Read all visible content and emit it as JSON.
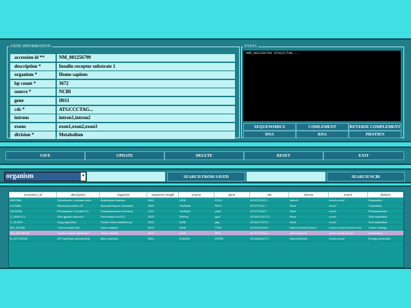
{
  "gene_info": {
    "legend": "GENE INFORMATION",
    "fields": [
      {
        "label": "accession id **",
        "value": "NM_001256799"
      },
      {
        "label": "description *",
        "value": "Insulin receptor substrate 1"
      },
      {
        "label": "organism *",
        "value": "Homo sapiens"
      },
      {
        "label": "bp count *",
        "value": "3672"
      },
      {
        "label": "source *",
        "value": "NCBI"
      },
      {
        "label": "gene",
        "value": "IRS1"
      },
      {
        "label": "cds *",
        "value": "ATGCCCTAG..."
      },
      {
        "label": "introns",
        "value": "intron1,intron2"
      },
      {
        "label": "exons",
        "value": "exon1,exon2,exon3"
      },
      {
        "label": "division *",
        "value": "Metabolism"
      }
    ]
  },
  "fasta": {
    "legend": "FASTA",
    "content": ">NM_001256799 ATGCCCTAG...",
    "buttons": {
      "sequenomics": "SEQUENOMICS",
      "complement": "COMLEMENT",
      "reverse_complement": "REVERSE COMPLEMENT",
      "dna": "DNA",
      "rna": "RNA",
      "protein": "PROTIEN"
    }
  },
  "actions": {
    "save": "SAVE",
    "update": "UPDATE",
    "delete": "DELETE",
    "reset": "RESET",
    "exit": "EXIT"
  },
  "search": {
    "field": "organism",
    "saved_button": "SEARCH FROM SAVED",
    "ncbi_button": "SEARCH NCBI"
  },
  "table": {
    "columns": [
      "accession_id",
      "description",
      "organism",
      "sequence length",
      "source",
      "gene",
      "cds",
      "introns",
      "exons",
      "division"
    ],
    "rows": [
      [
        "NR07954",
        "Cytochrome c oxidase subu",
        "Arabidopsis thaliana",
        "1542",
        "NCBI",
        "COX1",
        "ATGGTAGCC...",
        "intronX",
        "exon1,exon2",
        "Respiration"
      ],
      [
        "rr123456",
        "Ribosomal protein L5",
        "Saccharomyces cerevisiae",
        "1503",
        "GenBank",
        "RPL5",
        "ATGTTGAC...",
        "None",
        "exon1",
        "Translation"
      ],
      [
        "J3123456",
        "Photosystem II protein D1",
        "Chlamydomonas reinhardt",
        "1123",
        "GenBank",
        "psbA",
        "ATGTTGACT...",
        "None",
        "exon1",
        "Photosynthesis"
      ],
      [
        "C_000913.3",
        "DNA gyrase subunit A",
        "Escherichia coli K12",
        "2625",
        "RefSeq",
        "gyrA",
        "ATGAGCGCTG...",
        "None",
        "exon1",
        "DNA replication"
      ],
      [
        "C_001802",
        "Gag polyprotein",
        "Human immunodeficiency",
        "1503",
        "NCBI",
        "gag",
        "ATGGGTGCG...",
        "None",
        "exon1",
        "Viral replication"
      ],
      [
        "NM_000546",
        "Tumor protein p53",
        "Homo sapiens",
        "3919",
        "NCBI",
        "TP53",
        "ATGGAGGAG...",
        "intron1,intron2,intron3",
        "exon1,exon2,exon3,exon4",
        "Cancer biology"
      ],
      [
        "NM_001256799",
        "Insulin receptor substrate 1",
        "Homo sapiens",
        "3672",
        "NCBI",
        "IRS1",
        "ATGCCCTAG...",
        "intron1,intron2",
        "exon1,exon2,exon3",
        "Metabolism"
      ],
      [
        "M_007752345",
        "ATP synthase subunit beta",
        "Mus musculus",
        "4621",
        "Ensembl",
        "ATP5B",
        "ATGAAAACCT...",
        "intron4,intron8",
        "exon1,exon2",
        "Energy production"
      ]
    ]
  }
}
